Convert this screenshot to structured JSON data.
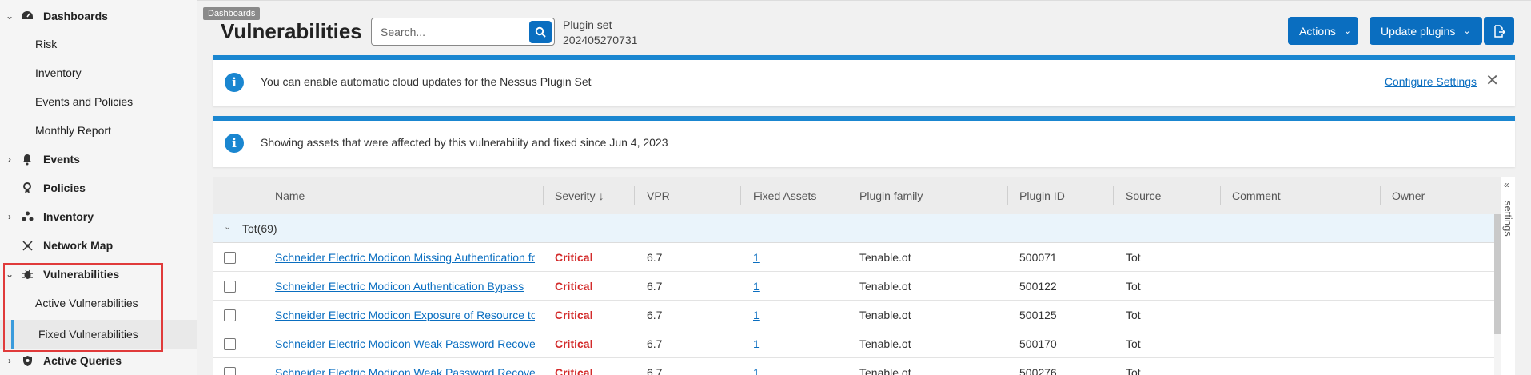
{
  "sidebar": {
    "items": [
      {
        "label": "Dashboards",
        "icon": "dashboard-icon",
        "expanded": true
      },
      {
        "label": "Risk"
      },
      {
        "label": "Inventory"
      },
      {
        "label": "Events and Policies"
      },
      {
        "label": "Monthly Report"
      },
      {
        "label": "Events",
        "icon": "bell-icon",
        "expanded": false
      },
      {
        "label": "Policies",
        "icon": "policy-icon"
      },
      {
        "label": "Inventory",
        "icon": "inventory-icon",
        "expanded": false
      },
      {
        "label": "Network Map",
        "icon": "network-map-icon"
      },
      {
        "label": "Vulnerabilities",
        "icon": "bug-icon",
        "expanded": true
      },
      {
        "label": "Active Vulnerabilities"
      },
      {
        "label": "Fixed Vulnerabilities",
        "active": true
      },
      {
        "label": "Active Queries",
        "icon": "shield-icon",
        "expanded": false
      }
    ]
  },
  "header": {
    "tooltip": "Dashboards",
    "title": "Vulnerabilities",
    "search_placeholder": "Search...",
    "plugin_set_label": "Plugin set",
    "plugin_set_value": "202405270731",
    "actions_label": "Actions",
    "update_label": "Update plugins"
  },
  "banners": [
    {
      "text": "You can enable automatic cloud updates for the Nessus Plugin Set",
      "link": "Configure Settings"
    },
    {
      "text": "Showing assets that were affected by this vulnerability and fixed since Jun 4, 2023"
    }
  ],
  "table": {
    "columns": [
      "Name",
      "Severity ↓",
      "VPR",
      "Fixed Assets",
      "Plugin family",
      "Plugin ID",
      "Source",
      "Comment",
      "Owner"
    ],
    "group_label": "Tot",
    "group_count": "(69)",
    "rows": [
      {
        "name": "Schneider Electric Modicon Missing Authentication for Critical Function",
        "severity": "Critical",
        "vpr": "6.7",
        "fixed_assets": "1",
        "family": "Tenable.ot",
        "plugin_id": "500071",
        "source": "Tot"
      },
      {
        "name": "Schneider Electric Modicon Authentication Bypass",
        "severity": "Critical",
        "vpr": "6.7",
        "fixed_assets": "1",
        "family": "Tenable.ot",
        "plugin_id": "500122",
        "source": "Tot"
      },
      {
        "name": "Schneider Electric Modicon Exposure of Resource to Wrong Sphere",
        "severity": "Critical",
        "vpr": "6.7",
        "fixed_assets": "1",
        "family": "Tenable.ot",
        "plugin_id": "500125",
        "source": "Tot"
      },
      {
        "name": "Schneider Electric Modicon Weak Password Recovery Mechanism",
        "severity": "Critical",
        "vpr": "6.7",
        "fixed_assets": "1",
        "family": "Tenable.ot",
        "plugin_id": "500170",
        "source": "Tot"
      },
      {
        "name": "Schneider Electric Modicon Weak Password Recovery Mechanism",
        "severity": "Critical",
        "vpr": "6.7",
        "fixed_assets": "1",
        "family": "Tenable.ot",
        "plugin_id": "500276",
        "source": "Tot"
      }
    ],
    "settings_label": "settings"
  },
  "colors": {
    "primary": "#0a6ec0",
    "banner": "#1a86d0",
    "critical": "#d32b2b",
    "highlight": "#e03a3a"
  }
}
